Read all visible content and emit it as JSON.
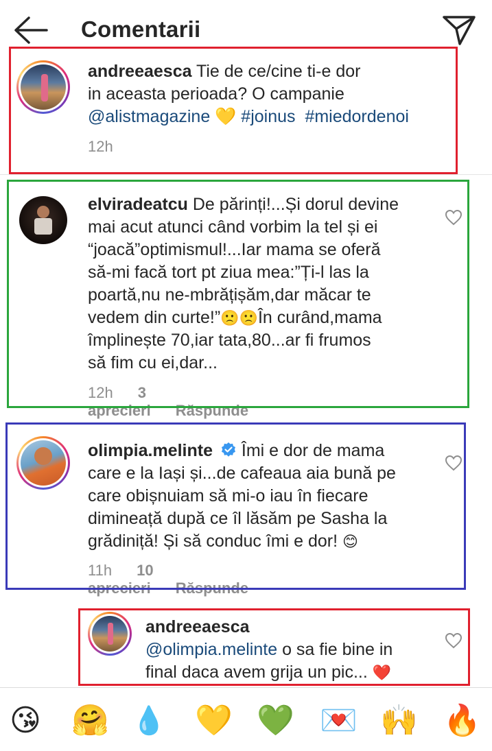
{
  "header": {
    "title": "Comentarii",
    "back_icon": "arrow-left-icon",
    "send_icon": "paper-plane-icon"
  },
  "comments": [
    {
      "username": "andreeaesca",
      "text_part1": " Tie de ce/cine ti-e dor",
      "text_line2": "in aceasta perioada? O campanie",
      "mention": "@alistmagazine",
      "emoji": "💛",
      "tag1": "#joinus",
      "tag2": "#miedordenoi",
      "time": "12h"
    },
    {
      "username": "elviradeatcu",
      "line1": " De părinți!...Și dorul devine",
      "line2": "mai acut atunci când vorbim la tel și ei",
      "line3": "“joacă”optimismul!...Iar mama se oferă",
      "line4": "să-mi facă tort pt ziua mea:”Ți-l las la",
      "line5": "poartă,nu ne-mbrățișăm,dar măcar te",
      "line6a": "vedem din curte!”",
      "line6_emoji": "🙁🙁",
      "line6b": "În curând,mama",
      "line7": "împlinește 70,iar tata,80...ar fi frumos",
      "line8": "să fim cu ei,dar...",
      "time": "12h",
      "likes": "3 aprecieri",
      "reply": "Răspunde"
    },
    {
      "username": "olimpia.melinte",
      "verified_icon": "verified-badge-icon",
      "line1": " Îmi e dor de mama",
      "line2": "care e la Iași și...de cafeaua aia bună pe",
      "line3": "care obișnuiam să mi-o iau în fiecare",
      "line4": "dimineață după ce îl lăsăm pe Sasha la",
      "line5": "grădiniță! Și să conduc îmi e dor! ",
      "line5_emoji": "😊",
      "time": "11h",
      "likes": "10 aprecieri",
      "reply": "Răspunde"
    },
    {
      "username": "andreeaesca",
      "mention": "@olimpia.melinte",
      "line1_rest": " o sa fie bine in",
      "line2": "final daca avem grija un pic... ",
      "line2_emoji": "❤️"
    }
  ],
  "emoji_bar": [
    "😘",
    "🤗",
    "💧",
    "💛",
    "💚",
    "💌",
    "🙌",
    "🔥"
  ],
  "colors": {
    "box_red": "#e0202e",
    "box_green": "#2aa63c",
    "box_blue": "#3a3ab8",
    "mention": "#1a4a7a",
    "meta": "#8e8e8e"
  }
}
